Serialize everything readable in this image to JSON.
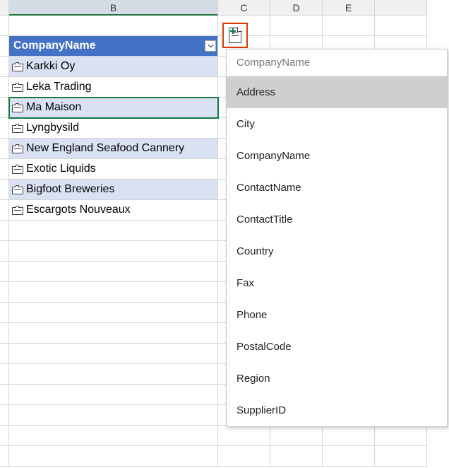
{
  "columns": {
    "B": "B",
    "C": "C",
    "D": "D",
    "E": "E"
  },
  "table": {
    "header": "CompanyName",
    "rows": [
      {
        "label": "Karkki Oy",
        "alt": false,
        "selected": false
      },
      {
        "label": "Leka Trading",
        "alt": true,
        "selected": false
      },
      {
        "label": "Ma Maison",
        "alt": false,
        "selected": true
      },
      {
        "label": "Lyngbysild",
        "alt": true,
        "selected": false
      },
      {
        "label": "New England Seafood Cannery",
        "alt": false,
        "selected": false
      },
      {
        "label": "Exotic Liquids",
        "alt": true,
        "selected": false
      },
      {
        "label": "Bigfoot Breweries",
        "alt": false,
        "selected": false
      },
      {
        "label": "Escargots Nouveaux",
        "alt": true,
        "selected": false
      }
    ]
  },
  "field_menu": {
    "header": "CompanyName",
    "items": [
      {
        "label": "Address",
        "selected": true
      },
      {
        "label": "City",
        "selected": false
      },
      {
        "label": "CompanyName",
        "selected": false
      },
      {
        "label": "ContactName",
        "selected": false
      },
      {
        "label": "ContactTitle",
        "selected": false
      },
      {
        "label": "Country",
        "selected": false
      },
      {
        "label": "Fax",
        "selected": false
      },
      {
        "label": "Phone",
        "selected": false
      },
      {
        "label": "PostalCode",
        "selected": false
      },
      {
        "label": "Region",
        "selected": false
      },
      {
        "label": "SupplierID",
        "selected": false
      }
    ]
  }
}
